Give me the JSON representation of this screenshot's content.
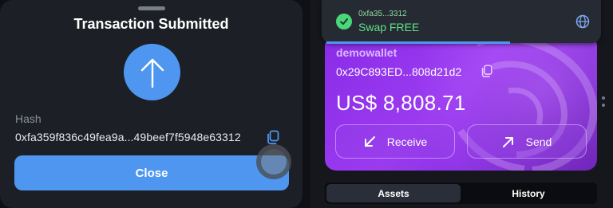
{
  "left_sheet": {
    "title": "Transaction Submitted",
    "hash_label": "Hash",
    "hash_value": "0xfa359f836c49fea9a...49beef7f5948e63312",
    "close_label": "Close",
    "icons": {
      "status": "arrow-up-icon",
      "copy": "copy-icon"
    },
    "accent_color": "#4f96f0"
  },
  "toast": {
    "address": "0xfa35...3312",
    "message": "Swap FREE",
    "icons": {
      "status": "check-icon",
      "network": "globe-icon"
    },
    "status_color": "#4ad67b"
  },
  "wallet_card": {
    "name": "demowallet",
    "address": "0x29C893ED...808d21d2",
    "balance": "US$ 8,808.71",
    "receive_label": "Receive",
    "send_label": "Send",
    "icons": {
      "copy": "copy-icon",
      "receive": "arrow-down-left-icon",
      "send": "arrow-up-right-icon"
    },
    "card_color": "#8a2be8"
  },
  "tabs": [
    {
      "label": "Assets",
      "selected": true
    },
    {
      "label": "History",
      "selected": false
    }
  ]
}
